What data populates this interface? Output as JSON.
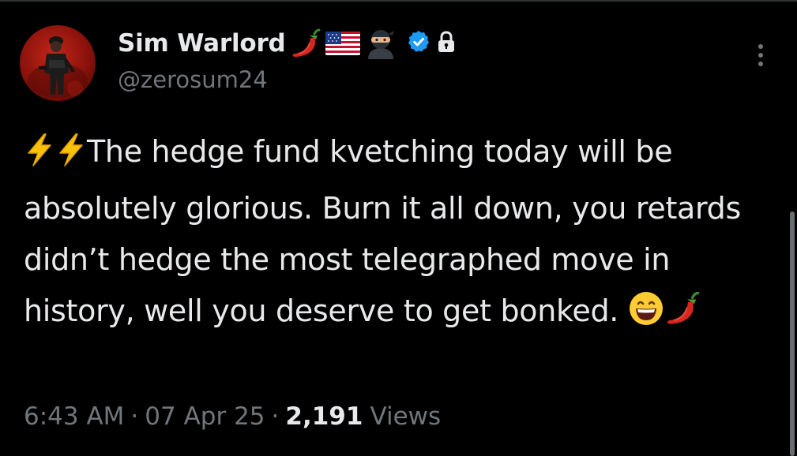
{
  "author": {
    "display_name": "Sim Warlord",
    "handle": "@zerosum24",
    "name_emojis": [
      "chili-pepper",
      "us-flag",
      "ninja"
    ],
    "verified_color": "#1d9bf0",
    "badges": [
      "verified-badge-icon",
      "lock-icon"
    ]
  },
  "tweet": {
    "lead_emojis": [
      "high-voltage",
      "high-voltage"
    ],
    "text": "The hedge fund kvetching today will be absolutely glorious. Burn it all down, you retards didn’t hedge the most telegraphed move in history, well you deserve to get bonked.",
    "trail_emojis": [
      "grinning-face",
      "chili-pepper"
    ]
  },
  "meta": {
    "time": "6:43 AM",
    "date": "07 Apr 25",
    "separator": "·",
    "views_count": "2,191",
    "views_label": "Views"
  },
  "colors": {
    "background": "#000000",
    "primary_text": "#e7e9ea",
    "secondary_text": "#71767b",
    "accent": "#1d9bf0"
  }
}
